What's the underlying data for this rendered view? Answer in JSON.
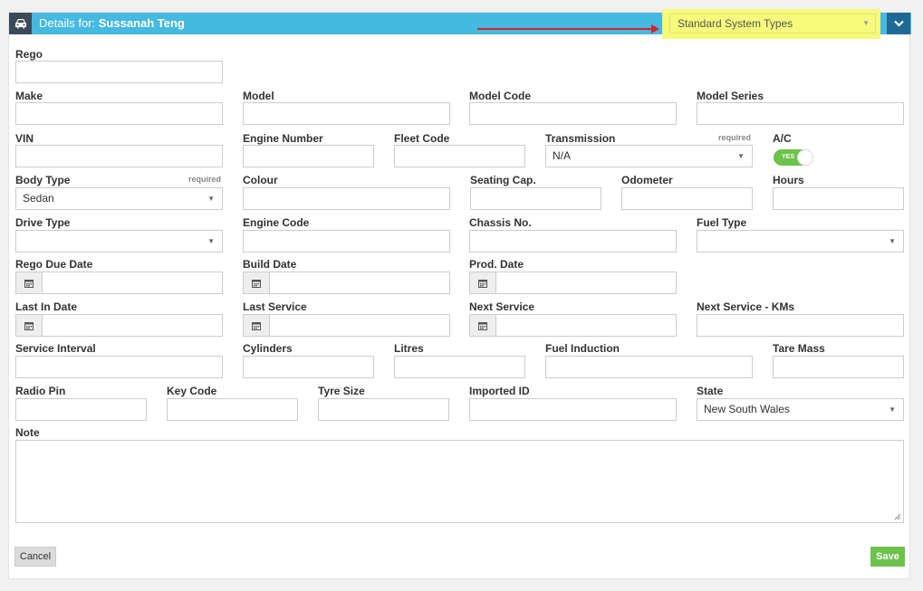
{
  "header": {
    "title_prefix": "Details for: ",
    "customer_name": "Sussanah Teng",
    "system_types": "Standard System Types"
  },
  "fields": {
    "rego": "Rego",
    "make": "Make",
    "model": "Model",
    "model_code": "Model Code",
    "model_series": "Model Series",
    "vin": "VIN",
    "engine_number": "Engine Number",
    "fleet_code": "Fleet Code",
    "transmission": "Transmission",
    "transmission_value": "N/A",
    "ac": "A/C",
    "ac_toggle": "YES",
    "body_type": "Body Type",
    "body_type_value": "Sedan",
    "colour": "Colour",
    "seating_cap": "Seating Cap.",
    "odometer": "Odometer",
    "hours": "Hours",
    "drive_type": "Drive Type",
    "engine_code": "Engine Code",
    "chassis_no": "Chassis No.",
    "fuel_type": "Fuel Type",
    "rego_due_date": "Rego Due Date",
    "build_date": "Build Date",
    "prod_date": "Prod. Date",
    "last_in_date": "Last In Date",
    "last_service": "Last Service",
    "next_service": "Next Service",
    "next_service_kms": "Next Service - KMs",
    "service_interval": "Service Interval",
    "cylinders": "Cylinders",
    "litres": "Litres",
    "fuel_induction": "Fuel Induction",
    "tare_mass": "Tare Mass",
    "radio_pin": "Radio Pin",
    "key_code": "Key Code",
    "tyre_size": "Tyre Size",
    "imported_id": "Imported ID",
    "state": "State",
    "state_value": "New South Wales",
    "note": "Note",
    "required": "required"
  },
  "buttons": {
    "cancel": "Cancel",
    "save": "Save"
  },
  "colors": {
    "header": "#45b9e0",
    "accent_dark": "#1e6a95",
    "highlight": "#f7f97a",
    "save": "#6cc24a",
    "arrow": "#d9232a"
  }
}
